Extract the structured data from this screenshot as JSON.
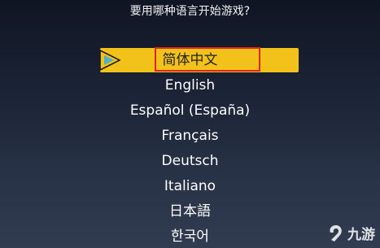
{
  "prompt": "要用哪种语言开始游戏?",
  "languages": [
    {
      "label": "简体中文",
      "selected": true
    },
    {
      "label": "English",
      "selected": false
    },
    {
      "label": "Español (España)",
      "selected": false
    },
    {
      "label": "Français",
      "selected": false
    },
    {
      "label": "Deutsch",
      "selected": false
    },
    {
      "label": "Italiano",
      "selected": false
    },
    {
      "label": "日本語",
      "selected": false
    },
    {
      "label": "한국어",
      "selected": false
    }
  ],
  "cursor_icon": "play-arrow-icon",
  "watermark": {
    "text": "九游",
    "icon": "jiuyou-logo-icon"
  },
  "colors": {
    "highlight": "#f2c21a",
    "annotation_frame": "#e0241b",
    "cursor": "#4fb0c6"
  }
}
